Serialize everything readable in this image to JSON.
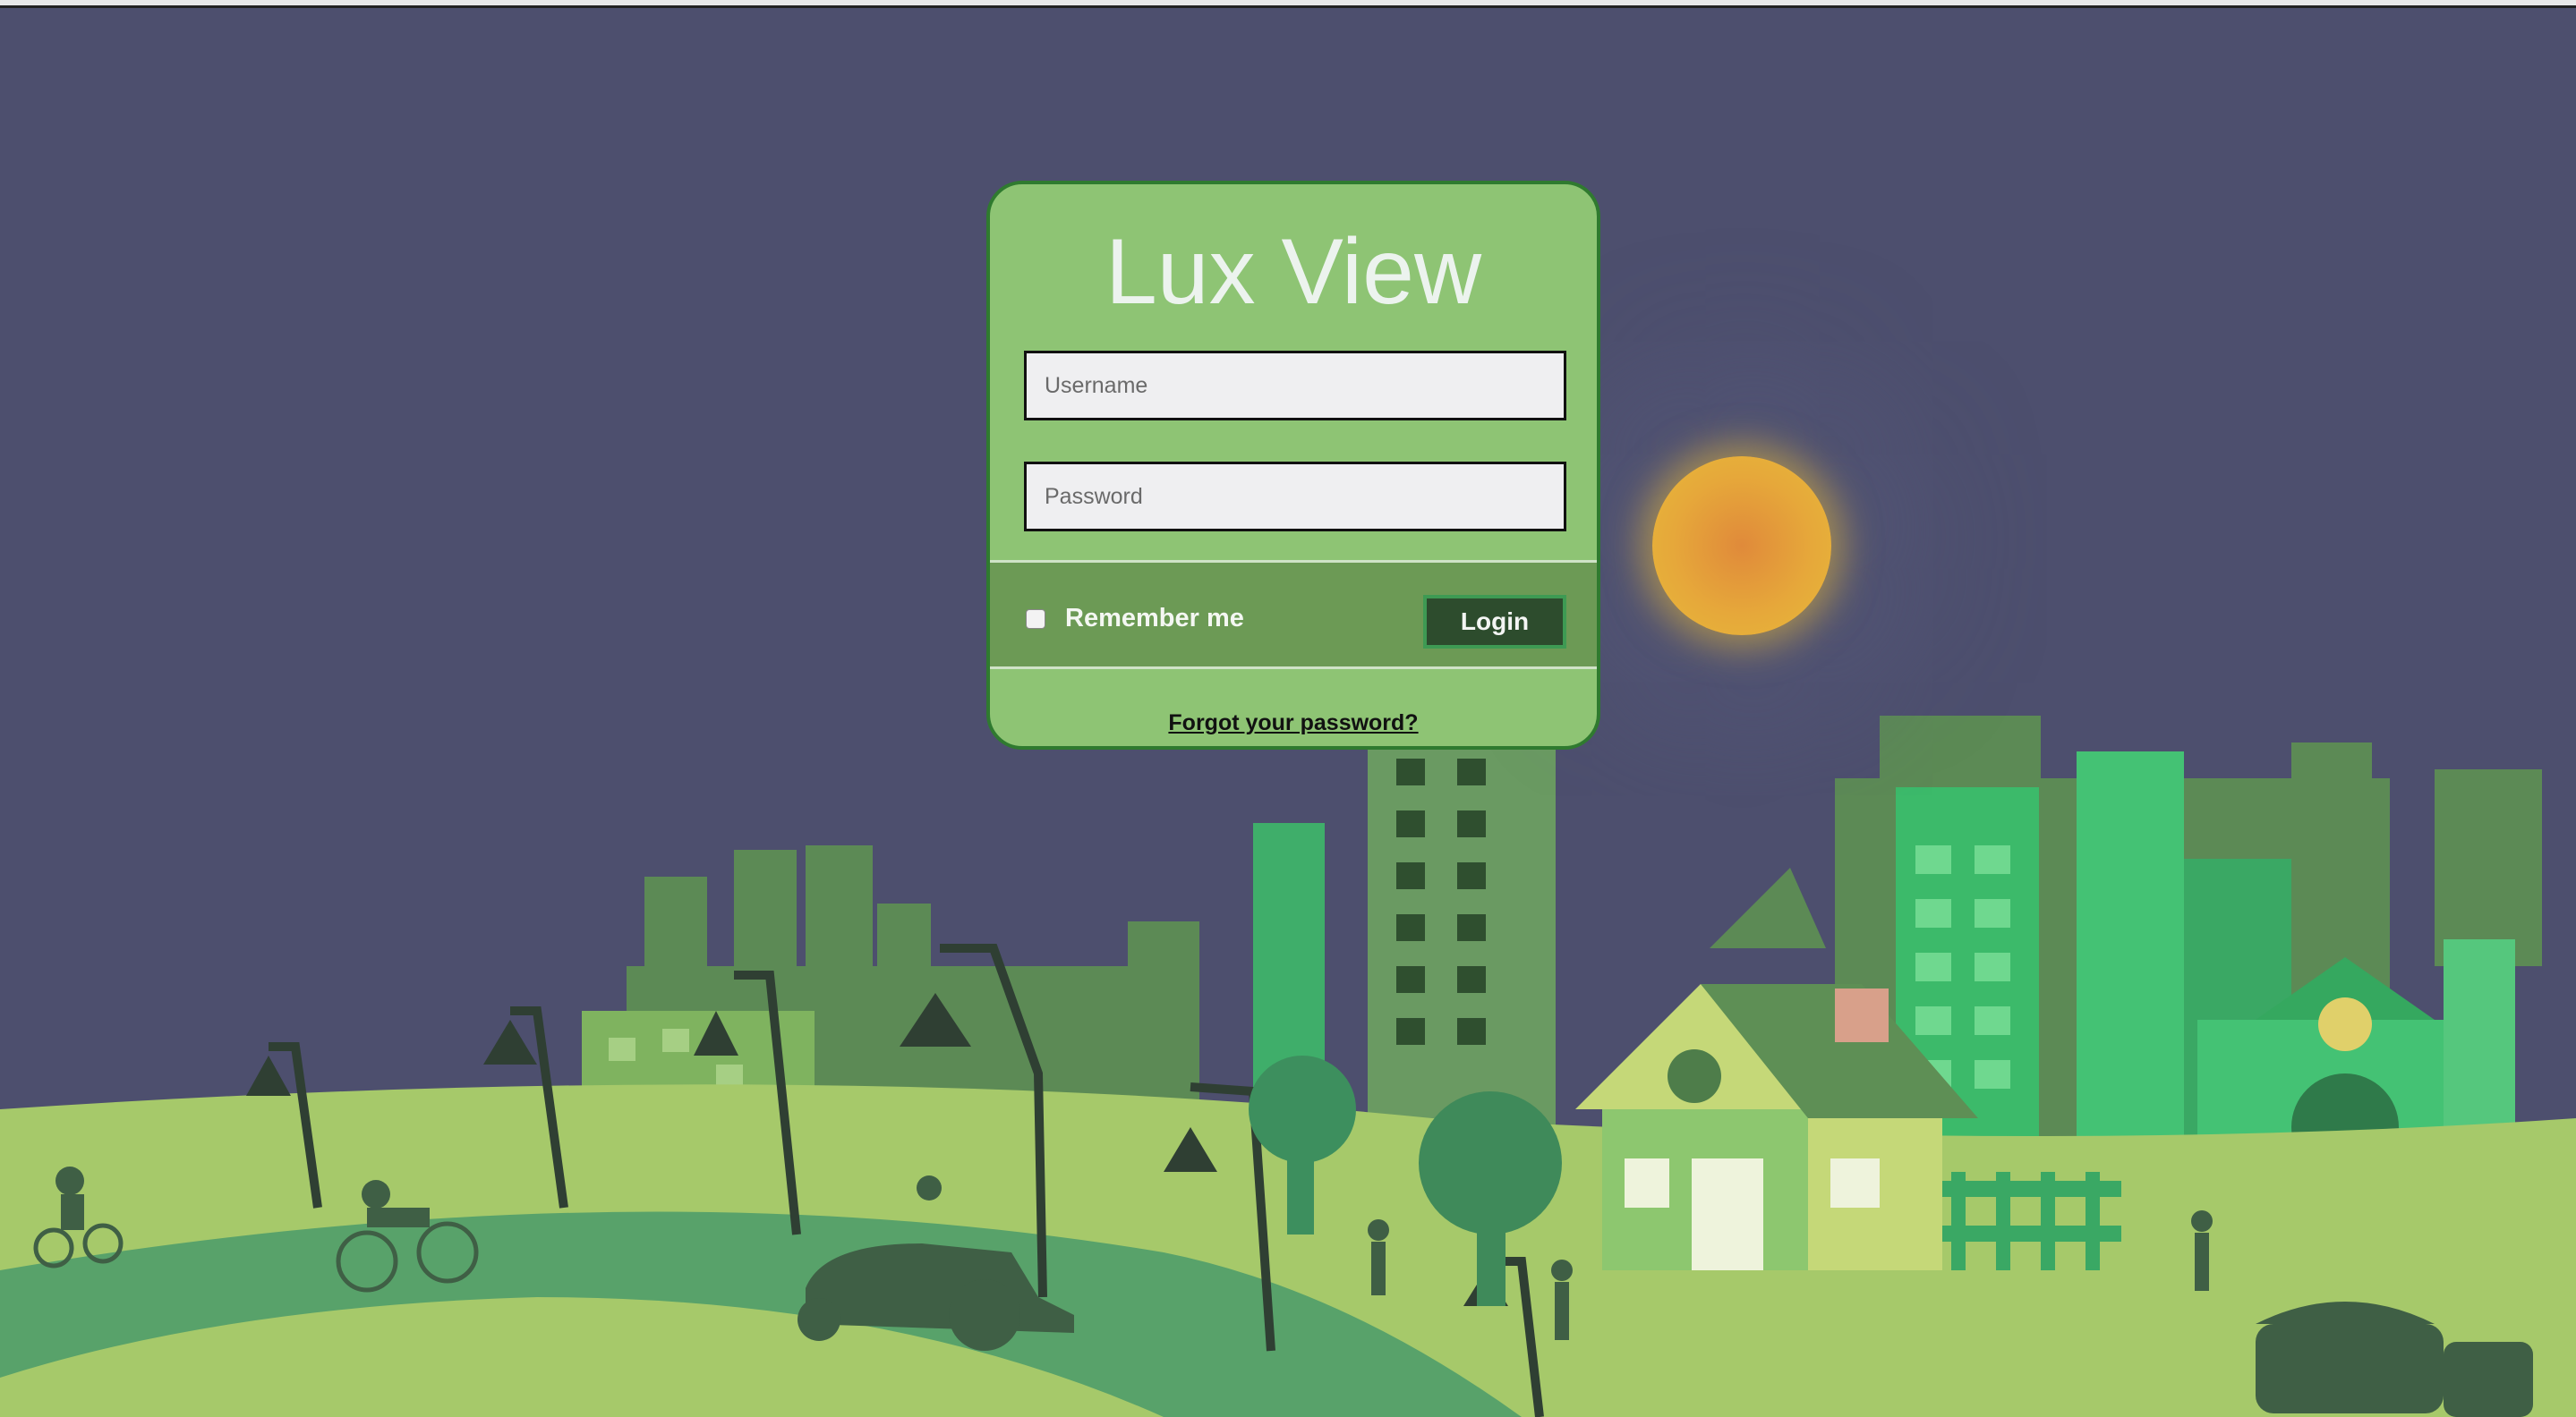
{
  "app": {
    "title": "Lux View"
  },
  "login": {
    "username_placeholder": "Username",
    "password_placeholder": "Password",
    "remember_label": "Remember me",
    "remember_checked": false,
    "login_label": "Login",
    "forgot_label": "Forgot your password?"
  },
  "colors": {
    "sky": "#4d4f6e",
    "card": "#8ec474",
    "card_border": "#2f7a2f",
    "action_bar": "#6c9a55",
    "login_button": "#2d4c2d",
    "sun": "#e6a83a"
  },
  "scene": {
    "icons": [
      "sun-icon",
      "city-skyline-icon",
      "street-lamp-icon",
      "cyclist-icon",
      "tractor-icon",
      "house-icon",
      "tree-icon",
      "church-icon",
      "truck-icon",
      "people-icon"
    ]
  }
}
